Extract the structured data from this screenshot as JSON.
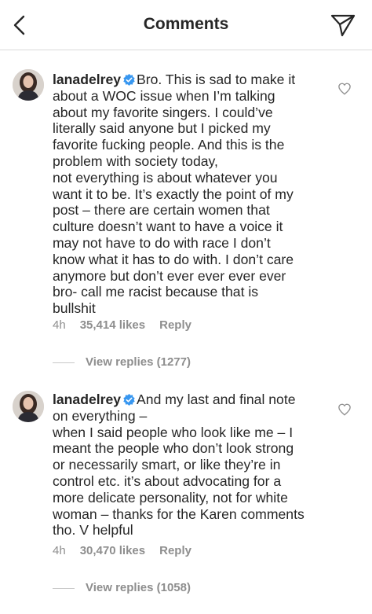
{
  "header": {
    "title": "Comments",
    "back_icon": "chevron-left-icon",
    "send_icon": "paper-plane-icon"
  },
  "comments": [
    {
      "username": "lanadelrey",
      "verified": true,
      "lines": [
        "Bro. This is sad to make it",
        "about a WOC issue when I’m talking",
        "about my favorite singers. I could’ve",
        "literally said anyone but I picked my",
        "favorite fucking people. And this is the",
        "problem with society today,",
        "not everything is about whatever you",
        "want it to be. It’s exactly the point of my",
        "post – there are certain women that",
        "culture doesn’t want to have a voice it",
        "may not have to do with race I don’t",
        "know what it has to do with. I don’t care",
        "anymore but don’t ever ever ever ever",
        "bro- call me racist because that is",
        "bullshit"
      ],
      "time": "4h",
      "likes": "35,414 likes",
      "reply": "Reply",
      "view_replies": "View replies (1277)"
    },
    {
      "username": "lanadelrey",
      "verified": true,
      "lines": [
        "And my last and final note",
        "on everything –",
        "when I said people who look like me – I",
        "meant the people who don’t look strong",
        "or necessarily smart, or like they’re in",
        "control etc. it’s about advocating for a",
        "more delicate personality, not for white",
        "woman – thanks for the Karen comments",
        "tho. V helpful"
      ],
      "time": "4h",
      "likes": "30,470 likes",
      "reply": "Reply",
      "view_replies": "View replies (1058)"
    }
  ],
  "colors": {
    "text": "#262626",
    "muted": "#8e8e8e",
    "verified": "#3897f0",
    "divider": "#dbdbdb"
  }
}
